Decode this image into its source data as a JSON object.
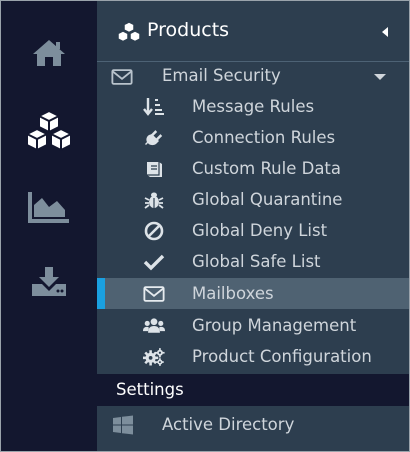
{
  "rail": {
    "items": [
      {
        "icon": "home-icon"
      },
      {
        "icon": "products-icon"
      },
      {
        "icon": "chart-icon"
      },
      {
        "icon": "download-icon"
      }
    ]
  },
  "panel": {
    "title": "Products",
    "title_icon": "products-cubes-icon",
    "collapse_icon": "caret-left-icon"
  },
  "email_security": {
    "label": "Email Security",
    "icon": "envelope-icon",
    "expand_icon": "caret-down-icon"
  },
  "submenu": [
    {
      "label": "Message Rules",
      "icon": "sort-numeric-icon"
    },
    {
      "label": "Connection Rules",
      "icon": "plug-icon"
    },
    {
      "label": "Custom Rule Data",
      "icon": "book-icon"
    },
    {
      "label": "Global Quarantine",
      "icon": "bug-icon"
    },
    {
      "label": "Global Deny List",
      "icon": "ban-icon"
    },
    {
      "label": "Global Safe List",
      "icon": "check-icon"
    },
    {
      "label": "Mailboxes",
      "icon": "envelope-icon",
      "active": true
    },
    {
      "label": "Group Management",
      "icon": "users-icon"
    },
    {
      "label": "Product Configuration",
      "icon": "gears-icon"
    }
  ],
  "settings": {
    "label": "Settings",
    "items": [
      {
        "label": "Active Directory",
        "icon": "windows-icon"
      }
    ]
  },
  "colors": {
    "rail_bg": "#13172f",
    "panel_bg": "#2d3e4f",
    "active_row_bg": "#4f6272",
    "active_accent": "#1aa0e0",
    "icon_gray": "#7d8e9c"
  }
}
